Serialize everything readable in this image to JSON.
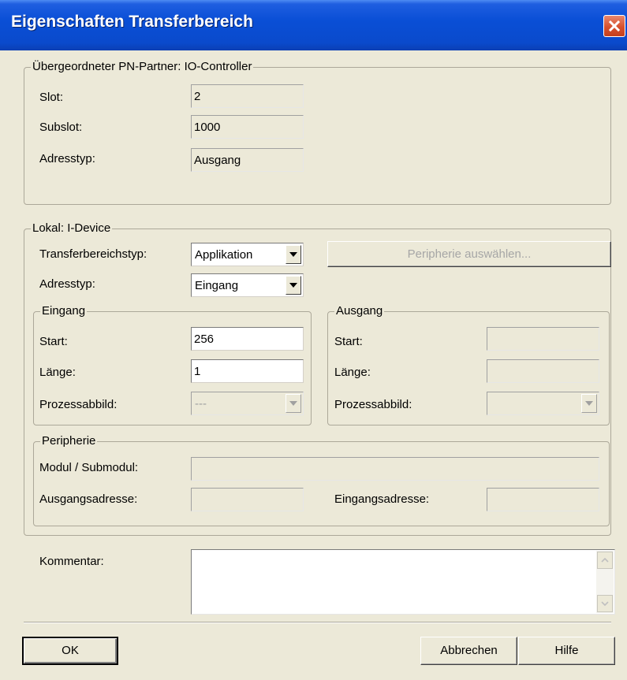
{
  "window": {
    "title": "Eigenschaften Transferbereich"
  },
  "partner": {
    "legend": "Übergeordneter PN-Partner: IO-Controller",
    "slot_label": "Slot:",
    "slot_value": "2",
    "subslot_label": "Subslot:",
    "subslot_value": "1000",
    "adresstyp_label": "Adresstyp:",
    "adresstyp_value": "Ausgang"
  },
  "local": {
    "legend": "Lokal: I-Device",
    "transfer_type_label": "Transferbereichstyp:",
    "transfer_type_value": "Applikation",
    "peripherie_button": "Peripherie auswählen...",
    "adresstyp_label": "Adresstyp:",
    "adresstyp_value": "Eingang",
    "eingang": {
      "legend": "Eingang",
      "start_label": "Start:",
      "start_value": "256",
      "laenge_label": "Länge:",
      "laenge_value": "1",
      "prozessabbild_label": "Prozessabbild:",
      "prozessabbild_value": "---"
    },
    "ausgang": {
      "legend": "Ausgang",
      "start_label": "Start:",
      "start_value": "",
      "laenge_label": "Länge:",
      "laenge_value": "",
      "prozessabbild_label": "Prozessabbild:",
      "prozessabbild_value": ""
    },
    "peripherie": {
      "legend": "Peripherie",
      "modul_label": "Modul / Submodul:",
      "modul_value": "",
      "ausgangsadresse_label": "Ausgangsadresse:",
      "ausgangsadresse_value": "",
      "eingangsadresse_label": "Eingangsadresse:",
      "eingangsadresse_value": ""
    }
  },
  "kommentar": {
    "label": "Kommentar:",
    "value": ""
  },
  "buttons": {
    "ok": "OK",
    "cancel": "Abbrechen",
    "help": "Hilfe"
  },
  "colors": {
    "titlebar": "#0a4fd6",
    "dialog_bg": "#ece9d8",
    "close": "#d7512e"
  },
  "icons": {
    "close": "close-icon",
    "dropdown": "chevron-down-icon",
    "scroll_up": "scroll-up-icon",
    "scroll_down": "scroll-down-icon"
  }
}
